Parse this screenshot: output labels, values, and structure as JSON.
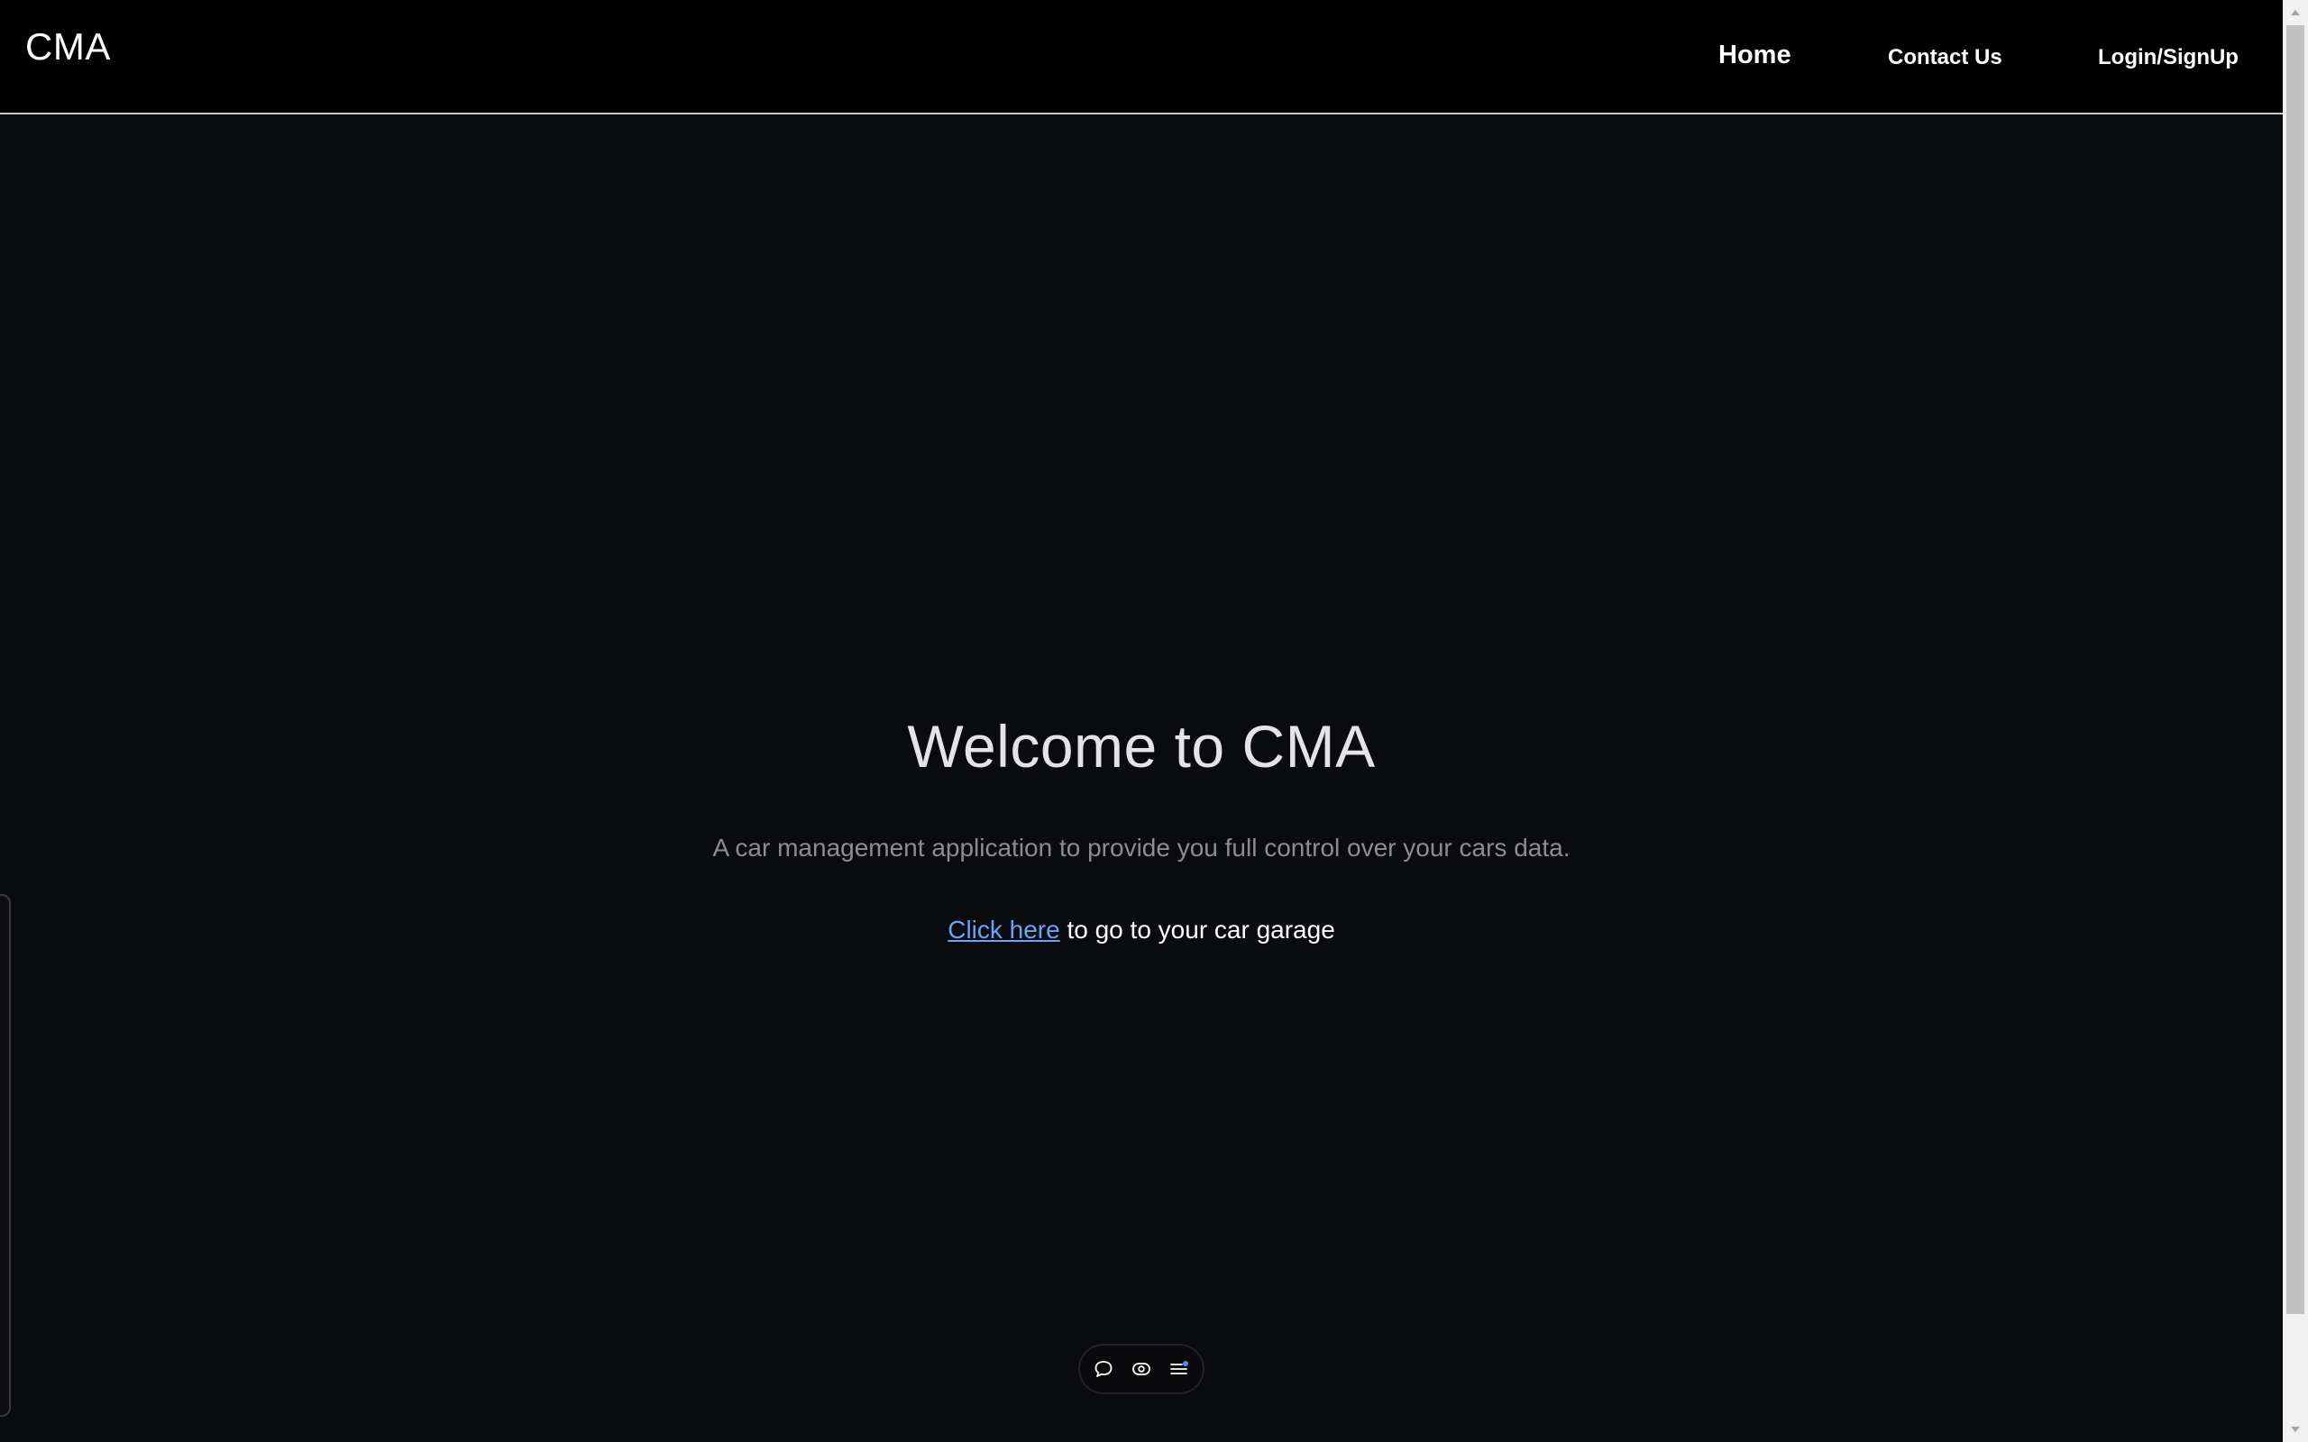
{
  "header": {
    "brand": "CMA",
    "nav": {
      "home": "Home",
      "contact": "Contact Us",
      "login": "Login/SignUp"
    }
  },
  "hero": {
    "title": "Welcome to CMA",
    "subtitle": "A car management application to provide you full control over your cars data.",
    "cta_link": "Click here",
    "cta_rest": " to go to your car garage"
  },
  "toolbar": {
    "icons": [
      "comment-icon",
      "eye-icon",
      "menu-icon"
    ]
  },
  "colors": {
    "background": "#0a0b0e",
    "header_bg": "#000000",
    "link": "#6ea3f0",
    "subtitle": "#8c8c92",
    "notification_dot": "#4a8cf0"
  }
}
